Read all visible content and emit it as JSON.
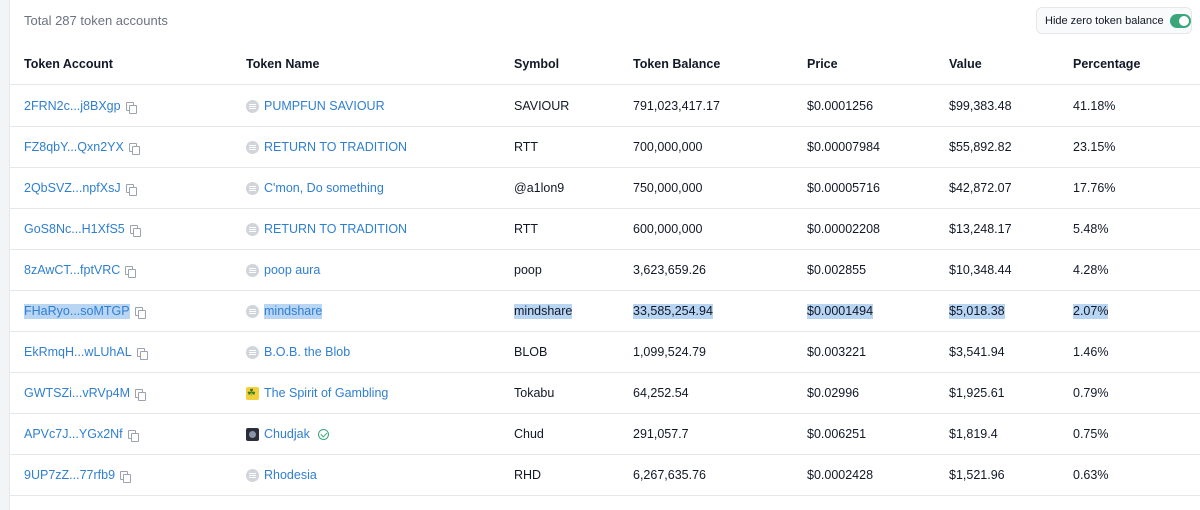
{
  "summary": {
    "total_text": "Total 287 token accounts"
  },
  "toggle": {
    "label": "Hide zero token balance",
    "on": true
  },
  "columns": [
    "Token Account",
    "Token Name",
    "Symbol",
    "Token Balance",
    "Price",
    "Value",
    "Percentage"
  ],
  "rows": [
    {
      "account": "2FRN2c...j8BXgp",
      "token_name": "PUMPFUN SAVIOUR",
      "symbol": "SAVIOUR",
      "balance": "791,023,417.17",
      "price": "$0.0001256",
      "value": "$99,383.48",
      "percentage": "41.18%",
      "icon": "generic-token-icon"
    },
    {
      "account": "FZ8qbY...Qxn2YX",
      "token_name": "RETURN TO TRADITION",
      "symbol": "RTT",
      "balance": "700,000,000",
      "price": "$0.00007984",
      "value": "$55,892.82",
      "percentage": "23.15%",
      "icon": "generic-token-icon"
    },
    {
      "account": "2QbSVZ...npfXsJ",
      "token_name": "C'mon, Do something",
      "symbol": "@a1lon9",
      "balance": "750,000,000",
      "price": "$0.00005716",
      "value": "$42,872.07",
      "percentage": "17.76%",
      "icon": "generic-token-icon"
    },
    {
      "account": "GoS8Nc...H1XfS5",
      "token_name": "RETURN TO TRADITION",
      "symbol": "RTT",
      "balance": "600,000,000",
      "price": "$0.00002208",
      "value": "$13,248.17",
      "percentage": "5.48%",
      "icon": "generic-token-icon"
    },
    {
      "account": "8zAwCT...fptVRC",
      "token_name": "poop aura",
      "symbol": "poop",
      "balance": "3,623,659.26",
      "price": "$0.002855",
      "value": "$10,348.44",
      "percentage": "4.28%",
      "icon": "generic-token-icon"
    },
    {
      "account": "FHaRyo...soMTGP",
      "token_name": "mindshare",
      "symbol": "mindshare",
      "balance": "33,585,254.94",
      "price": "$0.0001494",
      "value": "$5,018.38",
      "percentage": "2.07%",
      "icon": "generic-token-icon",
      "highlighted": true
    },
    {
      "account": "EkRmqH...wLUhAL",
      "token_name": "B.O.B. the Blob",
      "symbol": "BLOB",
      "balance": "1,099,524.79",
      "price": "$0.003221",
      "value": "$3,541.94",
      "percentage": "1.46%",
      "icon": "generic-token-icon"
    },
    {
      "account": "GWTSZi...vRVp4M",
      "token_name": "The Spirit of Gambling",
      "symbol": "Tokabu",
      "balance": "64,252.54",
      "price": "$0.02996",
      "value": "$1,925.61",
      "percentage": "0.79%",
      "icon": "spirit-token-icon"
    },
    {
      "account": "APVc7J...YGx2Nf",
      "token_name": "Chudjak",
      "symbol": "Chud",
      "balance": "291,057.7",
      "price": "$0.006251",
      "value": "$1,819.4",
      "percentage": "0.75%",
      "icon": "chud-token-icon",
      "verified": true
    },
    {
      "account": "9UP7zZ...77rfb9",
      "token_name": "Rhodesia",
      "symbol": "RHD",
      "balance": "6,267,635.76",
      "price": "$0.0002428",
      "value": "$1,521.96",
      "percentage": "0.63%",
      "icon": "generic-token-icon"
    }
  ],
  "colors": {
    "link": "#2f7fd1",
    "toggle_on": "#3aa77a",
    "highlight": "#b9d5f4"
  }
}
